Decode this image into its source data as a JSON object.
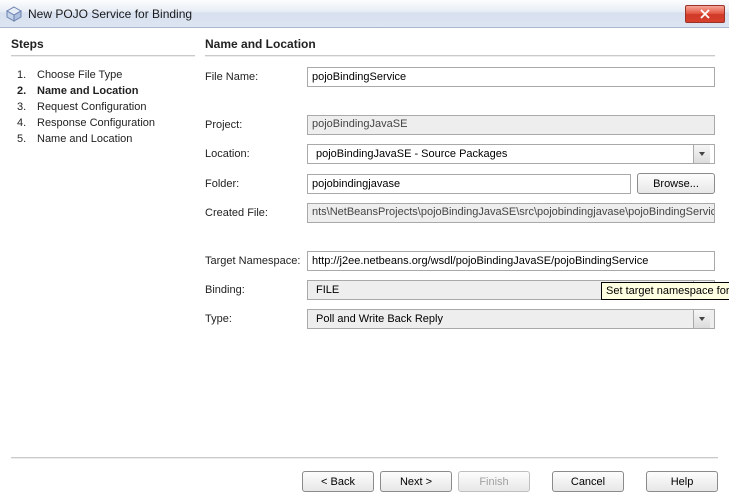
{
  "window": {
    "title": "New POJO Service for Binding"
  },
  "steps": {
    "title": "Steps",
    "items": [
      {
        "num": "1.",
        "label": "Choose File Type"
      },
      {
        "num": "2.",
        "label": "Name and Location"
      },
      {
        "num": "3.",
        "label": "Request Configuration"
      },
      {
        "num": "4.",
        "label": "Response Configuration"
      },
      {
        "num": "5.",
        "label": "Name and Location"
      }
    ]
  },
  "panel": {
    "title": "Name and Location",
    "fileName": {
      "label": "File Name:",
      "value": "pojoBindingService"
    },
    "project": {
      "label": "Project:",
      "value": "pojoBindingJavaSE"
    },
    "location": {
      "label": "Location:",
      "value": "pojoBindingJavaSE - Source Packages"
    },
    "folder": {
      "label": "Folder:",
      "value": "pojobindingjavase",
      "browse": "Browse..."
    },
    "createdFile": {
      "label": "Created File:",
      "value": "nts\\NetBeansProjects\\pojoBindingJavaSE\\src\\pojobindingjavase\\pojoBindingService.wsdl"
    },
    "targetNamespace": {
      "label": "Target Namespace:",
      "value": "http://j2ee.netbeans.org/wsdl/pojoBindingJavaSE/pojoBindingService"
    },
    "binding": {
      "label": "Binding:",
      "value": "FILE"
    },
    "type": {
      "label": "Type:",
      "value": "Poll and Write Back Reply"
    }
  },
  "tooltip": "Set target namespace for ",
  "footer": {
    "back": "< Back",
    "next": "Next >",
    "finish": "Finish",
    "cancel": "Cancel",
    "help": "Help"
  }
}
